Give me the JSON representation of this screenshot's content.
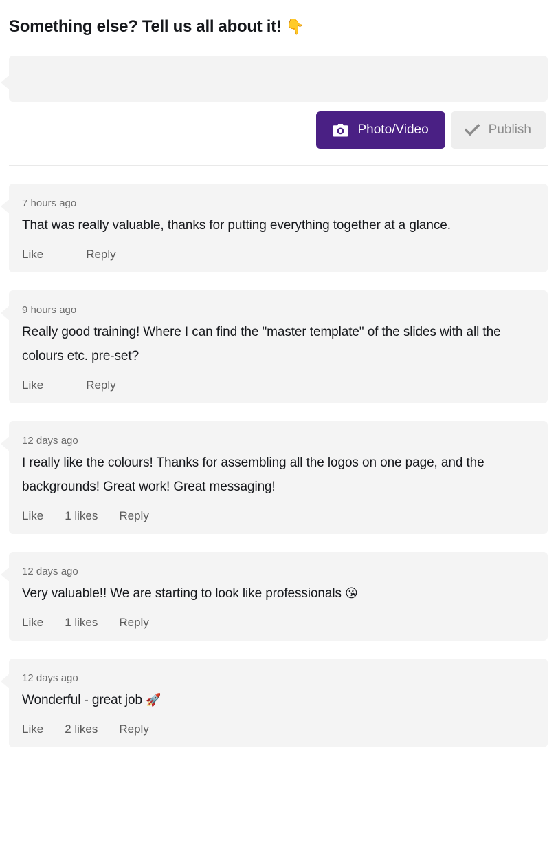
{
  "header": {
    "title": "Something else? Tell us all about it!",
    "emoji": "👇"
  },
  "composer": {
    "input_value": "",
    "placeholder": "",
    "photo_button_label": "Photo/Video",
    "photo_button_icon": "camera-icon",
    "photo_button_color": "#4a2084",
    "publish_button_label": "Publish",
    "publish_button_icon": "check-icon",
    "publish_button_color": "#eeeeee"
  },
  "comments": [
    {
      "time": "7 hours ago",
      "text": "That was really valuable, thanks for putting everything together at a glance.",
      "emoji": "",
      "like_label": "Like",
      "likes": "",
      "reply_label": "Reply"
    },
    {
      "time": "9 hours ago",
      "text": "Really good training! Where I can find the \"master template\" of the slides with all the colours etc. pre-set?",
      "emoji": "",
      "like_label": "Like",
      "likes": "",
      "reply_label": "Reply"
    },
    {
      "time": "12 days ago",
      "text": "I really like the colours! Thanks for assembling all the logos on one page, and the backgrounds! Great work! Great messaging!",
      "emoji": "",
      "like_label": "Like",
      "likes": "1 likes",
      "reply_label": "Reply"
    },
    {
      "time": "12 days ago",
      "text": "Very valuable!! We are starting to look like professionals ",
      "emoji": "😘",
      "like_label": "Like",
      "likes": "1 likes",
      "reply_label": "Reply"
    },
    {
      "time": "12 days ago",
      "text": "Wonderful - great job ",
      "emoji": "🚀",
      "like_label": "Like",
      "likes": "2 likes",
      "reply_label": "Reply"
    }
  ]
}
